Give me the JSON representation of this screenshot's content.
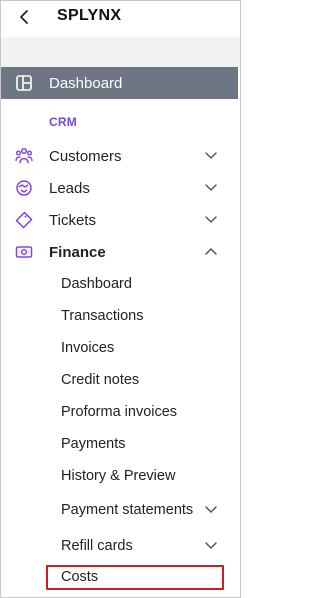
{
  "header": {
    "title": "SPLYNX",
    "back_icon": "chevron-left-icon"
  },
  "nav": {
    "dashboard_label": "Dashboard",
    "section_label": "CRM",
    "accent_color": "#7a45e6",
    "items": [
      {
        "label": "Customers",
        "icon": "users-icon",
        "expanded": false
      },
      {
        "label": "Leads",
        "icon": "handshake-icon",
        "expanded": false
      },
      {
        "label": "Tickets",
        "icon": "ticket-icon",
        "expanded": false
      },
      {
        "label": "Finance",
        "icon": "money-icon",
        "expanded": true
      }
    ],
    "finance_sub": [
      {
        "label": "Dashboard"
      },
      {
        "label": "Transactions"
      },
      {
        "label": "Invoices"
      },
      {
        "label": "Credit notes"
      },
      {
        "label": "Proforma invoices"
      },
      {
        "label": "Payments"
      },
      {
        "label": "History & Preview"
      },
      {
        "label": "Payment statements",
        "has_children": true
      },
      {
        "label": "Refill cards",
        "has_children": true
      },
      {
        "label": "Costs",
        "selected": true
      }
    ]
  }
}
